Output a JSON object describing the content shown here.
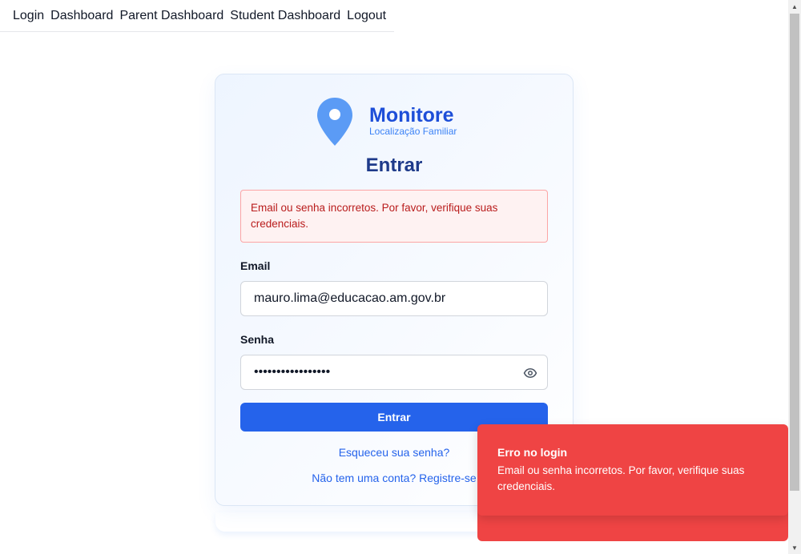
{
  "nav": {
    "items": [
      "Login",
      "Dashboard",
      "Parent Dashboard",
      "Student Dashboard",
      "Logout"
    ]
  },
  "brand": {
    "name": "Monitore",
    "tagline": "Localização Familiar",
    "icon": "map-pin-icon",
    "color": "#1d4ed8"
  },
  "login": {
    "title": "Entrar",
    "error_alert": "Email ou senha incorretos. Por favor, verifique suas credenciais.",
    "email_label": "Email",
    "email_value": "mauro.lima@educacao.am.gov.br",
    "password_label": "Senha",
    "password_value": "•••••••••••••••••",
    "show_password_icon": "eye-icon",
    "submit_label": "Entrar",
    "forgot_link": "Esqueceu sua senha?",
    "register_link": "Não tem uma conta? Registre-se"
  },
  "toast": {
    "title": "Erro no login",
    "message": "Email ou senha incorretos. Por favor, verifique suas credenciais.",
    "color": "#ef4444"
  },
  "colors": {
    "primary": "#2563eb",
    "error_text": "#b91c1c",
    "error_bg": "#fef2f2"
  }
}
